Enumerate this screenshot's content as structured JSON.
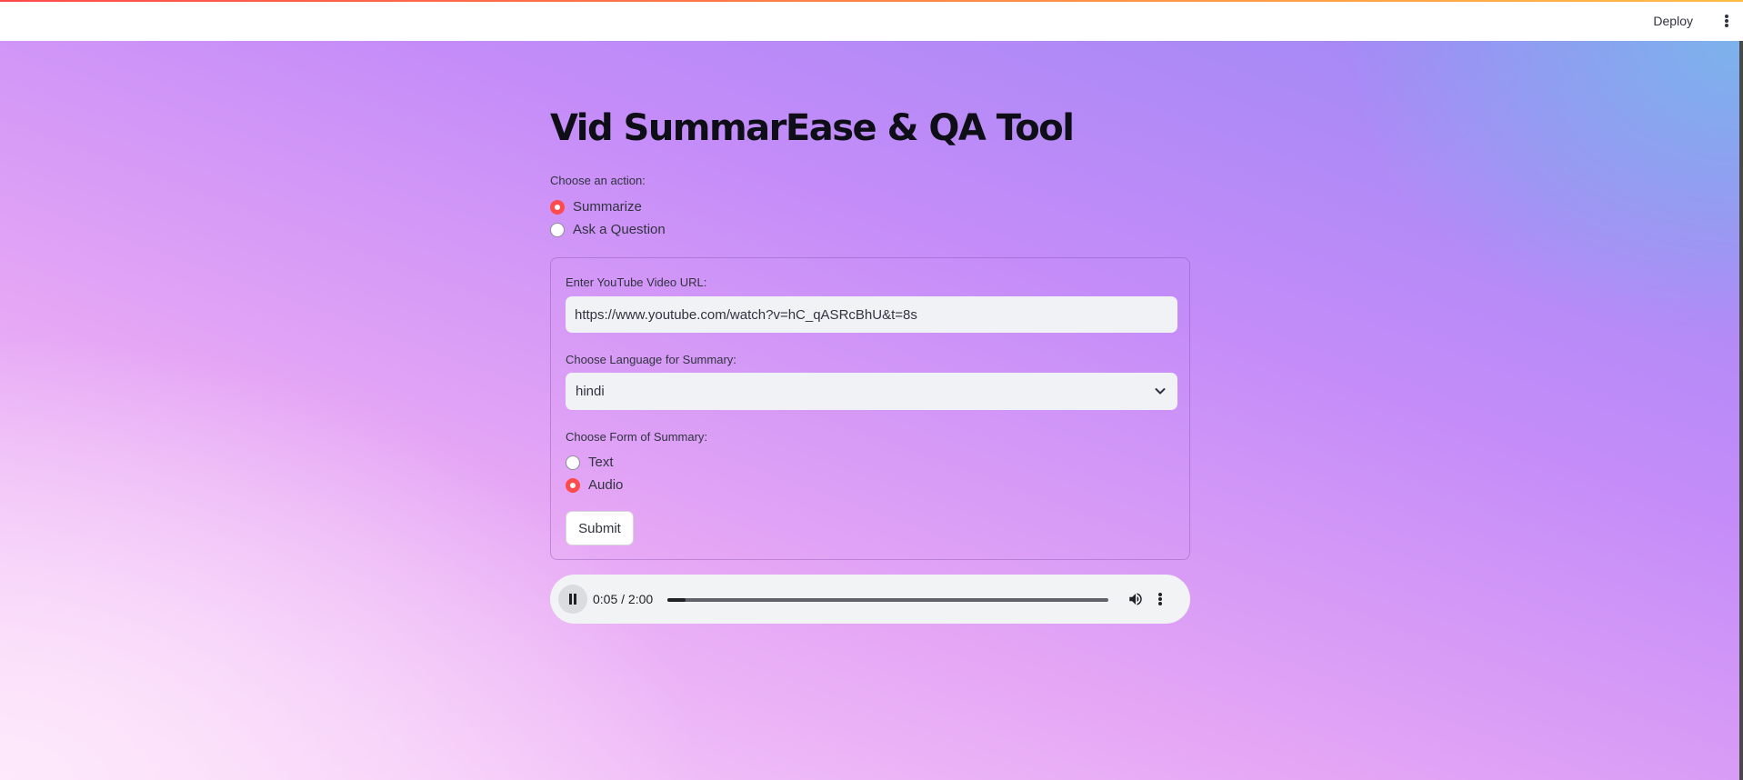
{
  "header": {
    "deploy_label": "Deploy",
    "menu_icon": "kebab-menu-icon"
  },
  "page": {
    "title": "Vid SummarEase & QA Tool",
    "action_label": "Choose an action:",
    "actions": [
      {
        "label": "Summarize",
        "selected": true
      },
      {
        "label": "Ask a Question",
        "selected": false
      }
    ]
  },
  "form": {
    "url_label": "Enter YouTube Video URL:",
    "url_value": "https://www.youtube.com/watch?v=hC_qASRcBhU&t=8s",
    "language_label": "Choose Language for Summary:",
    "language_value": "hindi",
    "summary_form_label": "Choose Form of Summary:",
    "summary_forms": [
      {
        "label": "Text",
        "selected": false
      },
      {
        "label": "Audio",
        "selected": true
      }
    ],
    "submit_label": "Submit"
  },
  "audio_player": {
    "state": "playing",
    "time_display": "0:05 / 2:00",
    "progress_fraction": 0.0417
  },
  "colors": {
    "accent": "#ff4b4b",
    "input_bg": "#f0f2f6",
    "player_bg": "#f1f3f4"
  }
}
